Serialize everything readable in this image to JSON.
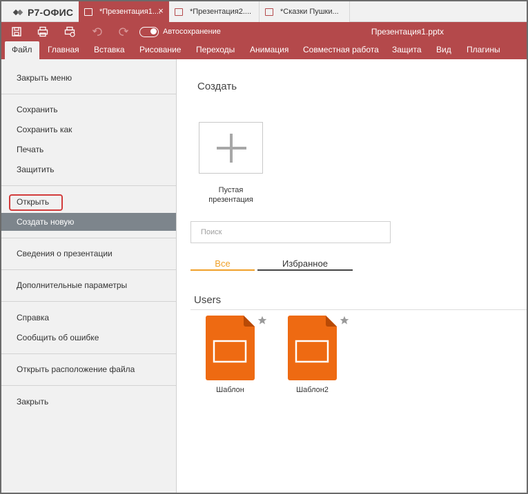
{
  "app": {
    "logo_text": "Р7-ОФИС"
  },
  "doc_tabs": [
    {
      "label": "*Презентация1....",
      "active": true
    },
    {
      "label": "*Презентация2....",
      "active": false
    },
    {
      "label": "*Сказки Пушки...",
      "active": false
    }
  ],
  "toolbar": {
    "autosave_label": "Автосохранение",
    "autosave_on": true,
    "doc_title": "Презентация1.pptx"
  },
  "menu_tabs": [
    "Файл",
    "Главная",
    "Вставка",
    "Рисование",
    "Переходы",
    "Анимация",
    "Совместная работа",
    "Защита",
    "Вид",
    "Плагины"
  ],
  "file_menu": {
    "close_menu": "Закрыть меню",
    "save": "Сохранить",
    "save_as": "Сохранить как",
    "print": "Печать",
    "protect": "Защитить",
    "open": "Открыть",
    "create_new": "Создать новую",
    "info": "Сведения о презентации",
    "advanced": "Дополнительные параметры",
    "help": "Справка",
    "report_bug": "Сообщить об ошибке",
    "open_location": "Открыть расположение файла",
    "close": "Закрыть"
  },
  "create_panel": {
    "title": "Создать",
    "blank_label_line1": "Пустая",
    "blank_label_line2": "презентация",
    "search_placeholder": "Поиск",
    "filter_all": "Все",
    "filter_favorites": "Избранное",
    "group_title": "Users",
    "templates": [
      {
        "name": "Шаблон"
      },
      {
        "name": "Шаблон2"
      }
    ]
  },
  "colors": {
    "accent": "#b4494b",
    "selected_item": "#7d858c",
    "template_orange": "#ee6a12",
    "filter_active": "#f0a028"
  }
}
